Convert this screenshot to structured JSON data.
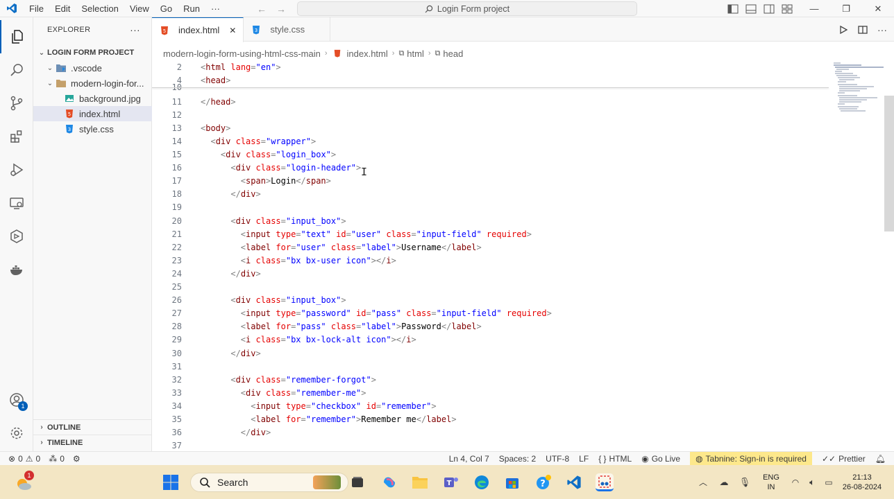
{
  "titlebar": {
    "menu": [
      "File",
      "Edit",
      "Selection",
      "View",
      "Go",
      "Run",
      "···"
    ],
    "command_center": "Login Form project"
  },
  "activitybar": {
    "accounts_badge": "1"
  },
  "sidebar": {
    "title": "EXPLORER",
    "more": "···",
    "project": "LOGIN FORM PROJECT",
    "items": [
      {
        "label": ".vscode",
        "type": "folder"
      },
      {
        "label": "modern-login-for...",
        "type": "folder"
      },
      {
        "label": "background.jpg",
        "type": "image"
      },
      {
        "label": "index.html",
        "type": "html"
      },
      {
        "label": "style.css",
        "type": "css"
      }
    ],
    "outline": "OUTLINE",
    "timeline": "TIMELINE"
  },
  "tabs": [
    {
      "label": "index.html",
      "active": true
    },
    {
      "label": "style.css",
      "active": false
    }
  ],
  "breadcrumbs": [
    "modern-login-form-using-html-css-main",
    "index.html",
    "html",
    "head"
  ],
  "code_lines": [
    {
      "n": "2",
      "html": "<span class='p'>&lt;</span><span class='t'>html</span> <span class='a'>lang</span><span class='p'>=</span><span class='v'>\"en\"</span><span class='p'>&gt;</span>"
    },
    {
      "n": "4",
      "html": "<span class='p'>&lt;</span><span class='t'>head</span><span class='p'>&gt;</span>"
    },
    {
      "n": "10",
      "html": ""
    },
    {
      "n": "11",
      "html": "<span class='p'>&lt;/</span><span class='t'>head</span><span class='p'>&gt;</span>"
    },
    {
      "n": "12",
      "html": ""
    },
    {
      "n": "13",
      "html": "<span class='p'>&lt;</span><span class='t'>body</span><span class='p'>&gt;</span>"
    },
    {
      "n": "14",
      "html": "  <span class='p'>&lt;</span><span class='t'>div</span> <span class='a'>class</span><span class='p'>=</span><span class='v'>\"wrapper\"</span><span class='p'>&gt;</span>"
    },
    {
      "n": "15",
      "html": "    <span class='p'>&lt;</span><span class='t'>div</span> <span class='a'>class</span><span class='p'>=</span><span class='v'>\"login_box\"</span><span class='p'>&gt;</span>"
    },
    {
      "n": "16",
      "html": "      <span class='p'>&lt;</span><span class='t'>div</span> <span class='a'>class</span><span class='p'>=</span><span class='v'>\"login-header\"</span><span class='p'>&gt;</span>"
    },
    {
      "n": "17",
      "html": "        <span class='p'>&lt;</span><span class='t'>span</span><span class='p'>&gt;</span>Login<span class='p'>&lt;/</span><span class='t'>span</span><span class='p'>&gt;</span>"
    },
    {
      "n": "18",
      "html": "      <span class='p'>&lt;/</span><span class='t'>div</span><span class='p'>&gt;</span>"
    },
    {
      "n": "19",
      "html": ""
    },
    {
      "n": "20",
      "html": "      <span class='p'>&lt;</span><span class='t'>div</span> <span class='a'>class</span><span class='p'>=</span><span class='v'>\"input_box\"</span><span class='p'>&gt;</span>"
    },
    {
      "n": "21",
      "html": "        <span class='p'>&lt;</span><span class='t'>input</span> <span class='a'>type</span><span class='p'>=</span><span class='v'>\"text\"</span> <span class='a'>id</span><span class='p'>=</span><span class='v'>\"user\"</span> <span class='a'>class</span><span class='p'>=</span><span class='v'>\"input-field\"</span> <span class='a'>required</span><span class='p'>&gt;</span>"
    },
    {
      "n": "22",
      "html": "        <span class='p'>&lt;</span><span class='t'>label</span> <span class='a'>for</span><span class='p'>=</span><span class='v'>\"user\"</span> <span class='a'>class</span><span class='p'>=</span><span class='v'>\"label\"</span><span class='p'>&gt;</span>Username<span class='p'>&lt;/</span><span class='t'>label</span><span class='p'>&gt;</span>"
    },
    {
      "n": "23",
      "html": "        <span class='p'>&lt;</span><span class='t'>i</span> <span class='a'>class</span><span class='p'>=</span><span class='v'>\"bx bx-user icon\"</span><span class='p'>&gt;&lt;/</span><span class='t'>i</span><span class='p'>&gt;</span>"
    },
    {
      "n": "24",
      "html": "      <span class='p'>&lt;/</span><span class='t'>div</span><span class='p'>&gt;</span>"
    },
    {
      "n": "25",
      "html": ""
    },
    {
      "n": "26",
      "html": "      <span class='p'>&lt;</span><span class='t'>div</span> <span class='a'>class</span><span class='p'>=</span><span class='v'>\"input_box\"</span><span class='p'>&gt;</span>"
    },
    {
      "n": "27",
      "html": "        <span class='p'>&lt;</span><span class='t'>input</span> <span class='a'>type</span><span class='p'>=</span><span class='v'>\"password\"</span> <span class='a'>id</span><span class='p'>=</span><span class='v'>\"pass\"</span> <span class='a'>class</span><span class='p'>=</span><span class='v'>\"input-field\"</span> <span class='a'>required</span><span class='p'>&gt;</span>"
    },
    {
      "n": "28",
      "html": "        <span class='p'>&lt;</span><span class='t'>label</span> <span class='a'>for</span><span class='p'>=</span><span class='v'>\"pass\"</span> <span class='a'>class</span><span class='p'>=</span><span class='v'>\"label\"</span><span class='p'>&gt;</span>Password<span class='p'>&lt;/</span><span class='t'>label</span><span class='p'>&gt;</span>"
    },
    {
      "n": "29",
      "html": "        <span class='p'>&lt;</span><span class='t'>i</span> <span class='a'>class</span><span class='p'>=</span><span class='v'>\"bx bx-lock-alt icon\"</span><span class='p'>&gt;&lt;/</span><span class='t'>i</span><span class='p'>&gt;</span>"
    },
    {
      "n": "30",
      "html": "      <span class='p'>&lt;/</span><span class='t'>div</span><span class='p'>&gt;</span>"
    },
    {
      "n": "31",
      "html": ""
    },
    {
      "n": "32",
      "html": "      <span class='p'>&lt;</span><span class='t'>div</span> <span class='a'>class</span><span class='p'>=</span><span class='v'>\"remember-forgot\"</span><span class='p'>&gt;</span>"
    },
    {
      "n": "33",
      "html": "        <span class='p'>&lt;</span><span class='t'>div</span> <span class='a'>class</span><span class='p'>=</span><span class='v'>\"remember-me\"</span><span class='p'>&gt;</span>"
    },
    {
      "n": "34",
      "html": "          <span class='p'>&lt;</span><span class='t'>input</span> <span class='a'>type</span><span class='p'>=</span><span class='v'>\"checkbox\"</span> <span class='a'>id</span><span class='p'>=</span><span class='v'>\"remember\"</span><span class='p'>&gt;</span>"
    },
    {
      "n": "35",
      "html": "          <span class='p'>&lt;</span><span class='t'>label</span> <span class='a'>for</span><span class='p'>=</span><span class='v'>\"remember\"</span><span class='p'>&gt;</span>Remember me<span class='p'>&lt;/</span><span class='t'>label</span><span class='p'>&gt;</span>"
    },
    {
      "n": "36",
      "html": "        <span class='p'>&lt;/</span><span class='t'>div</span><span class='p'>&gt;</span>"
    },
    {
      "n": "37",
      "html": ""
    }
  ],
  "statusbar": {
    "errors": "0",
    "warnings": "0",
    "ports": "0",
    "position": "Ln 4, Col 7",
    "spaces": "Spaces: 2",
    "encoding": "UTF-8",
    "eol": "LF",
    "language": "HTML",
    "golive": "Go Live",
    "tabnine": "Tabnine: Sign-in is required",
    "prettier": "Prettier"
  },
  "taskbar": {
    "search": "Search",
    "lang_top": "ENG",
    "lang_bottom": "IN",
    "time": "21:13",
    "date": "26-08-2024",
    "weather_badge": "1"
  }
}
